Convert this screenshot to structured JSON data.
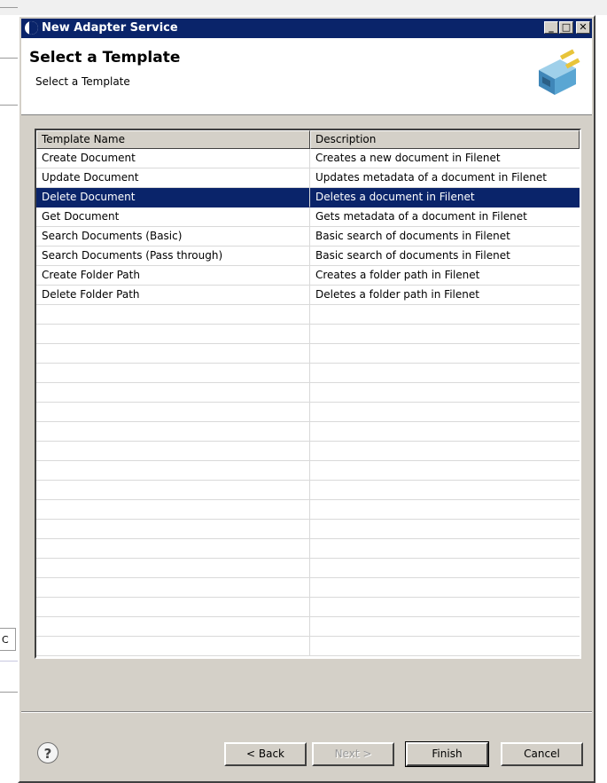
{
  "window": {
    "title": "New Adapter Service",
    "controls": {
      "minimize": "_",
      "maximize": "□",
      "close": "✕"
    }
  },
  "banner": {
    "title": "Select a Template",
    "subtitle": "Select a Template",
    "icon": "adapter-plug-icon"
  },
  "table": {
    "headers": [
      "Template Name",
      "Description"
    ],
    "rows": [
      {
        "name": "Create Document",
        "description": "Creates a new document in Filenet",
        "selected": false
      },
      {
        "name": "Update Document",
        "description": "Updates metadata of a document in Filenet",
        "selected": false
      },
      {
        "name": "Delete Document",
        "description": "Deletes a document in Filenet",
        "selected": true
      },
      {
        "name": "Get Document",
        "description": "Gets metadata of a document in Filenet",
        "selected": false
      },
      {
        "name": "Search Documents (Basic)",
        "description": "Basic search of documents in Filenet",
        "selected": false
      },
      {
        "name": "Search Documents (Pass through)",
        "description": "Basic search of documents in Filenet",
        "selected": false
      },
      {
        "name": "Create Folder Path",
        "description": "Creates a folder path in Filenet",
        "selected": false
      },
      {
        "name": "Delete Folder Path",
        "description": "Deletes a folder path in Filenet",
        "selected": false
      }
    ],
    "empty_rows": 18
  },
  "footer": {
    "help": "?",
    "back": "< Back",
    "next": "Next >",
    "finish": "Finish",
    "cancel": "Cancel"
  },
  "background": {
    "fragment": "C"
  },
  "colors": {
    "titlebar": "#0a246a",
    "selection": "#0a246a",
    "face": "#d4d0c8"
  }
}
